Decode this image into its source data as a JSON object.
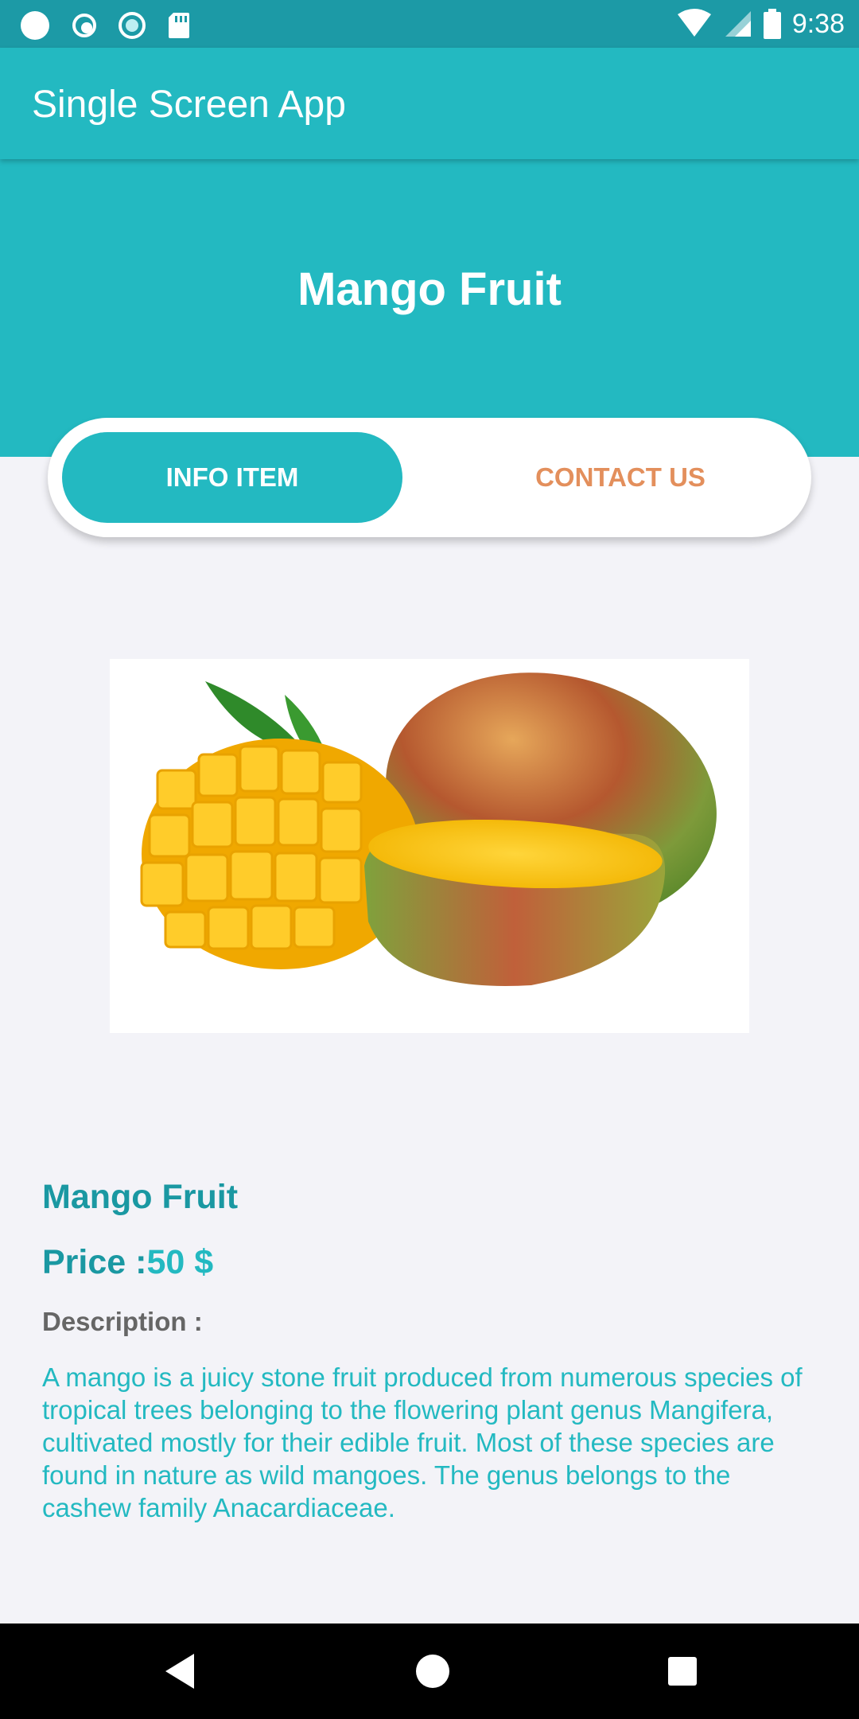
{
  "status_bar": {
    "time": "9:38",
    "left_icons": [
      "circle-icon",
      "sync-icon",
      "record-icon",
      "sd-card-icon"
    ],
    "right_icons": [
      "wifi-icon",
      "cell-signal-icon",
      "battery-icon"
    ]
  },
  "app_bar": {
    "title": "Single Screen App"
  },
  "hero": {
    "title": "Mango Fruit"
  },
  "tabs": {
    "active": "INFO ITEM",
    "inactive": "CONTACT US"
  },
  "product": {
    "name": "Mango Fruit",
    "price_label": "Price :",
    "price_value": "50 $",
    "description_label": "Description :",
    "description": "A mango is a juicy stone fruit produced from numerous species of tropical trees belonging to the flowering plant genus Mangifera, cultivated mostly for their edible fruit. Most of these species are found in nature as wild mangoes. The genus belongs to the cashew family Anacardiaceae.",
    "image_alt": "mango-image"
  },
  "nav_bar": {
    "buttons": [
      "back-icon",
      "home-icon",
      "recents-icon"
    ]
  },
  "colors": {
    "primary": "#23b9c1",
    "primary_dark": "#1c9aa6",
    "accent": "#e38f5c",
    "background": "#f3f3f8"
  }
}
